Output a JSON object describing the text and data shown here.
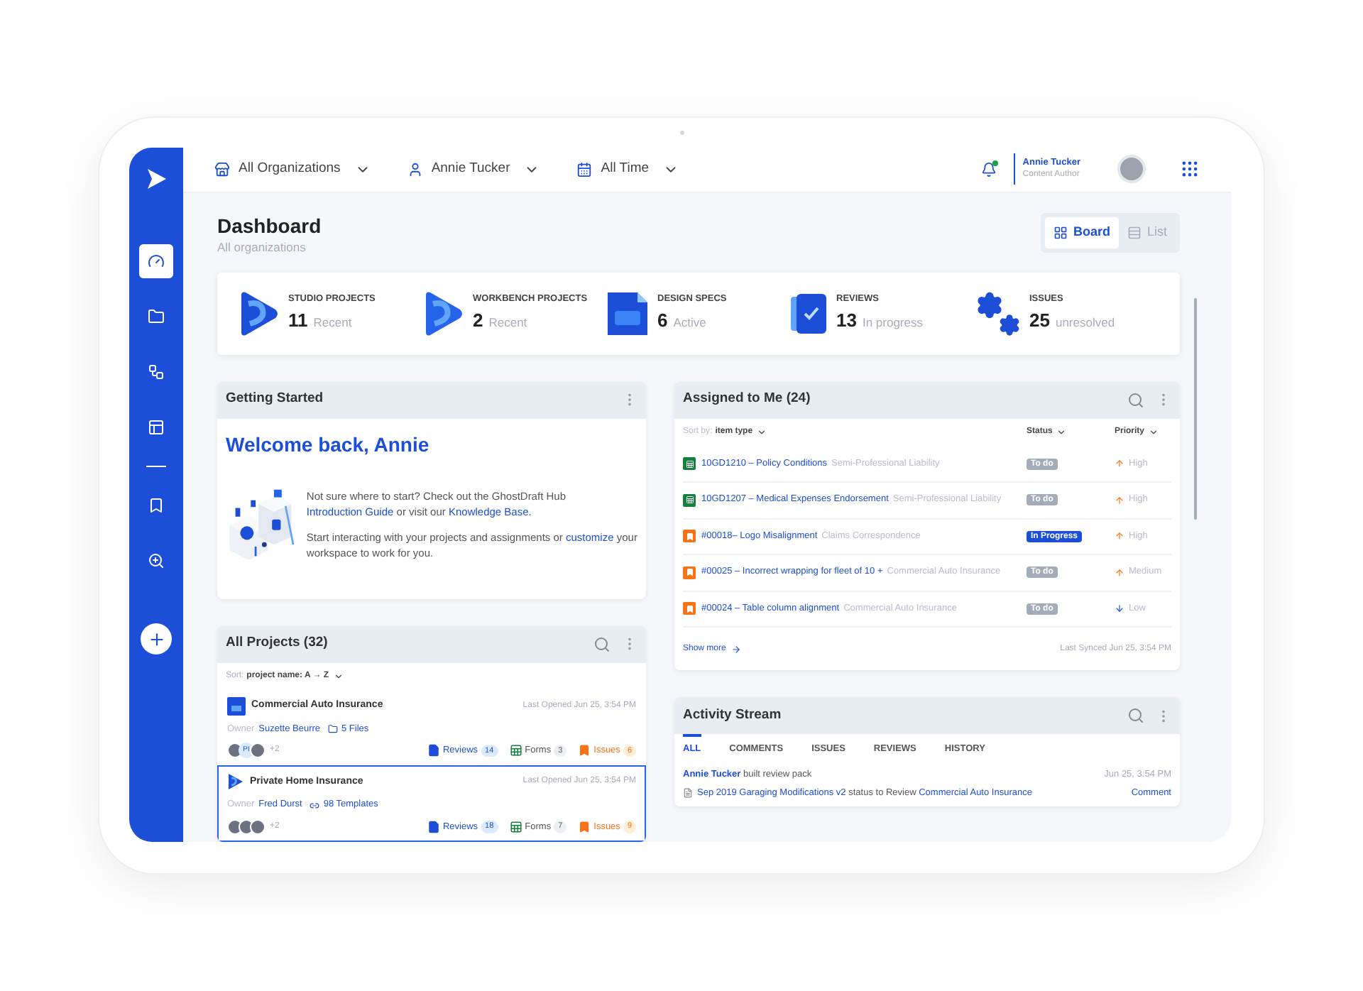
{
  "sidebar": {
    "items": [
      {
        "kind": "gauge",
        "selected": true
      },
      {
        "kind": "folder",
        "selected": false
      },
      {
        "kind": "workflow",
        "selected": false
      },
      {
        "kind": "layout",
        "selected": false
      },
      {
        "kind": "divider",
        "selected": false
      },
      {
        "kind": "bookmark",
        "selected": false
      },
      {
        "kind": "zoom",
        "selected": false
      }
    ]
  },
  "topbar": {
    "filters": [
      {
        "kind": "org",
        "label": "All Organizations"
      },
      {
        "kind": "user",
        "label": "Annie Tucker"
      },
      {
        "kind": "calendar",
        "label": "All Time"
      }
    ],
    "notifications": {
      "unread": true
    },
    "user": {
      "name": "Annie Tucker",
      "role": "Content Author"
    }
  },
  "page": {
    "title": "Dashboard",
    "subtitle": "All organizations",
    "views": [
      {
        "kind": "board",
        "label": "Board",
        "selected": true
      },
      {
        "kind": "list",
        "label": "List",
        "selected": false
      }
    ]
  },
  "stats": [
    {
      "kind": "studio",
      "label": "STUDIO PROJECTS",
      "count": "11",
      "note": "Recent"
    },
    {
      "kind": "workbench",
      "label": "WORKBENCH PROJECTS",
      "count": "2",
      "note": "Recent"
    },
    {
      "kind": "specs",
      "label": "DESIGN SPECS",
      "count": "6",
      "note": "Active"
    },
    {
      "kind": "reviews",
      "label": "REVIEWS",
      "count": "13",
      "note": "In progress"
    },
    {
      "kind": "issues",
      "label": "ISSUES",
      "count": "25",
      "note": "unresolved"
    }
  ],
  "getting_started": {
    "title": "Getting Started",
    "heading": "Welcome back, Annie",
    "paragraphs": [
      [
        {
          "text": "Not sure where to start? Check out the GhostDraft Hub "
        },
        {
          "link": "Introduction Guide"
        },
        {
          "text": " or visit our "
        },
        {
          "link": "Knowledge Base."
        }
      ],
      [
        {
          "text": "Start interacting with your projects and assignments or "
        },
        {
          "link": "customize"
        },
        {
          "text": " your workspace to work for you."
        }
      ]
    ]
  },
  "assigned": {
    "title": "Assigned to Me (24)",
    "sort_label": "Sort by:",
    "sort_value": "item type",
    "columns": [
      "Status",
      "Priority"
    ],
    "rows": [
      {
        "kind": "form",
        "title": "10GD1210 – Policy Conditions",
        "context": "Semi-Professional Liability",
        "status": {
          "kind": "todo",
          "label": "To do"
        },
        "priority": {
          "kind": "up",
          "label": "High"
        }
      },
      {
        "kind": "form",
        "title": "10GD1207 – Medical Expenses Endorsement",
        "context": "Semi-Professional Liability",
        "status": {
          "kind": "todo",
          "label": "To do"
        },
        "priority": {
          "kind": "up",
          "label": "High"
        }
      },
      {
        "kind": "issue",
        "title": "#00018– Logo Misalignment",
        "context": "Claims Correspondence",
        "status": {
          "kind": "progress",
          "label": "In Progress"
        },
        "priority": {
          "kind": "up",
          "label": "High"
        }
      },
      {
        "kind": "issue",
        "title": "#00025 – Incorrect wrapping for fleet of 10 +",
        "context": "Commercial Auto Insurance",
        "status": {
          "kind": "todo",
          "label": "To do"
        },
        "priority": {
          "kind": "up",
          "label": "Medium"
        }
      },
      {
        "kind": "issue",
        "title": "#00024 – Table column alignment",
        "context": "Commercial Auto Insurance",
        "status": {
          "kind": "todo",
          "label": "To do"
        },
        "priority": {
          "kind": "down",
          "label": "Low"
        }
      }
    ],
    "show_more": "Show more",
    "synced": "Last Synced Jun 25, 3:54 PM"
  },
  "projects": {
    "title": "All Projects (32)",
    "sort_label": "Sort:",
    "sort_value": "project name: A → Z",
    "items": [
      {
        "kind": "specs",
        "name": "Commercial Auto Insurance",
        "opened": "Last Opened Jun 25, 3:54 PM",
        "owner_label": "Owner",
        "owner": "Suzette Beurre",
        "assets": {
          "kind": "files",
          "label": "5 Files"
        },
        "members": [
          {
            "kind": "photo"
          },
          {
            "kind": "initials",
            "initials": "PI"
          },
          {
            "kind": "photo"
          }
        ],
        "more": "+2",
        "counts": [
          {
            "kind": "reviews",
            "label": "Reviews",
            "count": "14"
          },
          {
            "kind": "forms",
            "label": "Forms",
            "count": "3"
          },
          {
            "kind": "issues",
            "label": "Issues",
            "count": "6"
          }
        ],
        "selected": false
      },
      {
        "kind": "studio",
        "name": "Private Home Insurance",
        "opened": "Last Opened Jun 25, 3:54 PM",
        "owner_label": "Owner",
        "owner": "Fred Durst",
        "assets": {
          "kind": "templates",
          "label": "98 Templates"
        },
        "members": [
          {
            "kind": "photo"
          },
          {
            "kind": "photo"
          },
          {
            "kind": "photo"
          }
        ],
        "more": "+2",
        "counts": [
          {
            "kind": "reviews",
            "label": "Reviews",
            "count": "18"
          },
          {
            "kind": "forms",
            "label": "Forms",
            "count": "7"
          },
          {
            "kind": "issues",
            "label": "Issues",
            "count": "9"
          }
        ],
        "selected": true
      }
    ]
  },
  "activity": {
    "title": "Activity Stream",
    "tabs": [
      {
        "label": "ALL",
        "selected": true
      },
      {
        "label": "COMMENTS",
        "selected": false
      },
      {
        "label": "ISSUES",
        "selected": false
      },
      {
        "label": "REVIEWS",
        "selected": false
      },
      {
        "label": "HISTORY",
        "selected": false
      }
    ],
    "entries": [
      {
        "actor": "Annie Tucker",
        "action": "built review pack",
        "time": "Jun 25, 3:54 PM",
        "item": "Sep 2019 Garaging Modifications v2",
        "detail": "status to Review",
        "target": "Commercial Auto Insurance",
        "reply": "Comment"
      }
    ]
  }
}
